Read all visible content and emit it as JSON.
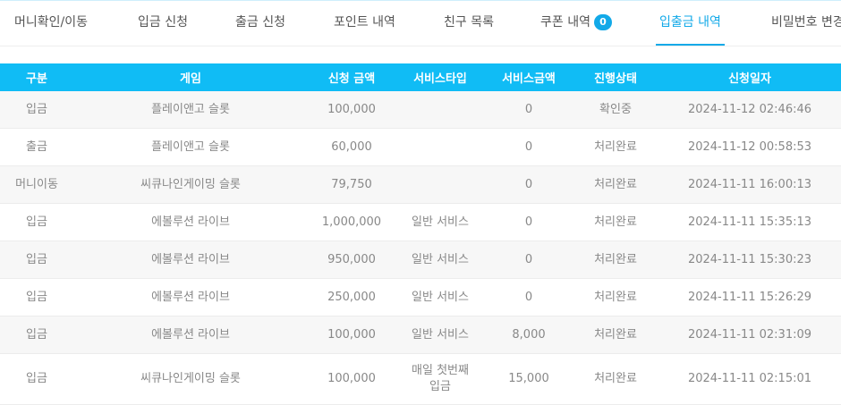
{
  "tabs": [
    {
      "label": "머니확인/이동",
      "active": false
    },
    {
      "label": "입금 신청",
      "active": false
    },
    {
      "label": "출금 신청",
      "active": false
    },
    {
      "label": "포인트 내역",
      "active": false
    },
    {
      "label": "친구 목록",
      "active": false
    },
    {
      "label": "쿠폰 내역",
      "badge": "0",
      "active": false
    },
    {
      "label": "입출금 내역",
      "active": true
    },
    {
      "label": "비밀번호 변경",
      "active": false
    }
  ],
  "table": {
    "headers": [
      "구분",
      "게임",
      "신청 금액",
      "서비스타입",
      "서비스금액",
      "진행상태",
      "신청일자"
    ],
    "rows": [
      [
        "입금",
        "플레이앤고 슬롯",
        "100,000",
        "",
        "0",
        "확인중",
        "2024-11-12 02:46:46"
      ],
      [
        "출금",
        "플레이앤고 슬롯",
        "60,000",
        "",
        "0",
        "처리완료",
        "2024-11-12 00:58:53"
      ],
      [
        "머니이동",
        "씨큐나인게이밍 슬롯",
        "79,750",
        "",
        "0",
        "처리완료",
        "2024-11-11 16:00:13"
      ],
      [
        "입금",
        "에볼루션 라이브",
        "1,000,000",
        "일반 서비스",
        "0",
        "처리완료",
        "2024-11-11 15:35:13"
      ],
      [
        "입금",
        "에볼루션 라이브",
        "950,000",
        "일반 서비스",
        "0",
        "처리완료",
        "2024-11-11 15:30:23"
      ],
      [
        "입금",
        "에볼루션 라이브",
        "250,000",
        "일반 서비스",
        "0",
        "처리완료",
        "2024-11-11 15:26:29"
      ],
      [
        "입금",
        "에볼루션 라이브",
        "100,000",
        "일반 서비스",
        "8,000",
        "처리완료",
        "2024-11-11 02:31:09"
      ],
      [
        "입금",
        "씨큐나인게이밍 슬롯",
        "100,000",
        "매일 첫번째\n입금",
        "15,000",
        "처리완료",
        "2024-11-11 02:15:01"
      ]
    ]
  },
  "colors": {
    "accent": "#12a9e8",
    "header_bg": "#10bcf5"
  }
}
